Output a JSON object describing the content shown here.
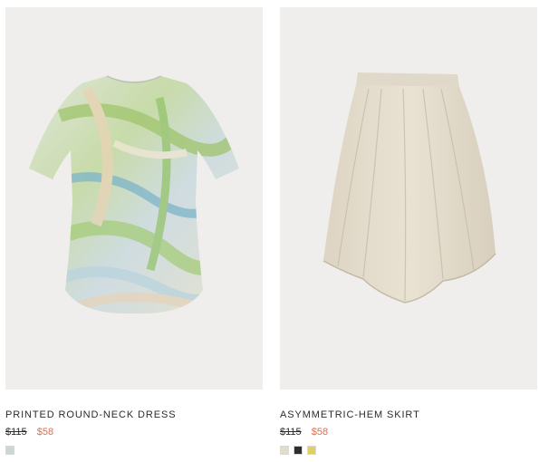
{
  "products": [
    {
      "name": "PRINTED ROUND-NECK DRESS",
      "original_price": "$115",
      "sale_price": "$58",
      "swatches": [
        {
          "color": "#c9d7d6",
          "label": "light-blue-print"
        }
      ]
    },
    {
      "name": "ASYMMETRIC-HEM SKIRT",
      "original_price": "$115",
      "sale_price": "$58",
      "swatches": [
        {
          "color": "#e4dccb",
          "label": "beige"
        },
        {
          "color": "#2e2e2e",
          "label": "black"
        },
        {
          "color": "#e2cf62",
          "label": "yellow"
        }
      ]
    }
  ],
  "colors": {
    "image_background": "#efeeed",
    "sale_price": "#e26d4f",
    "text": "#2b2b2b"
  }
}
